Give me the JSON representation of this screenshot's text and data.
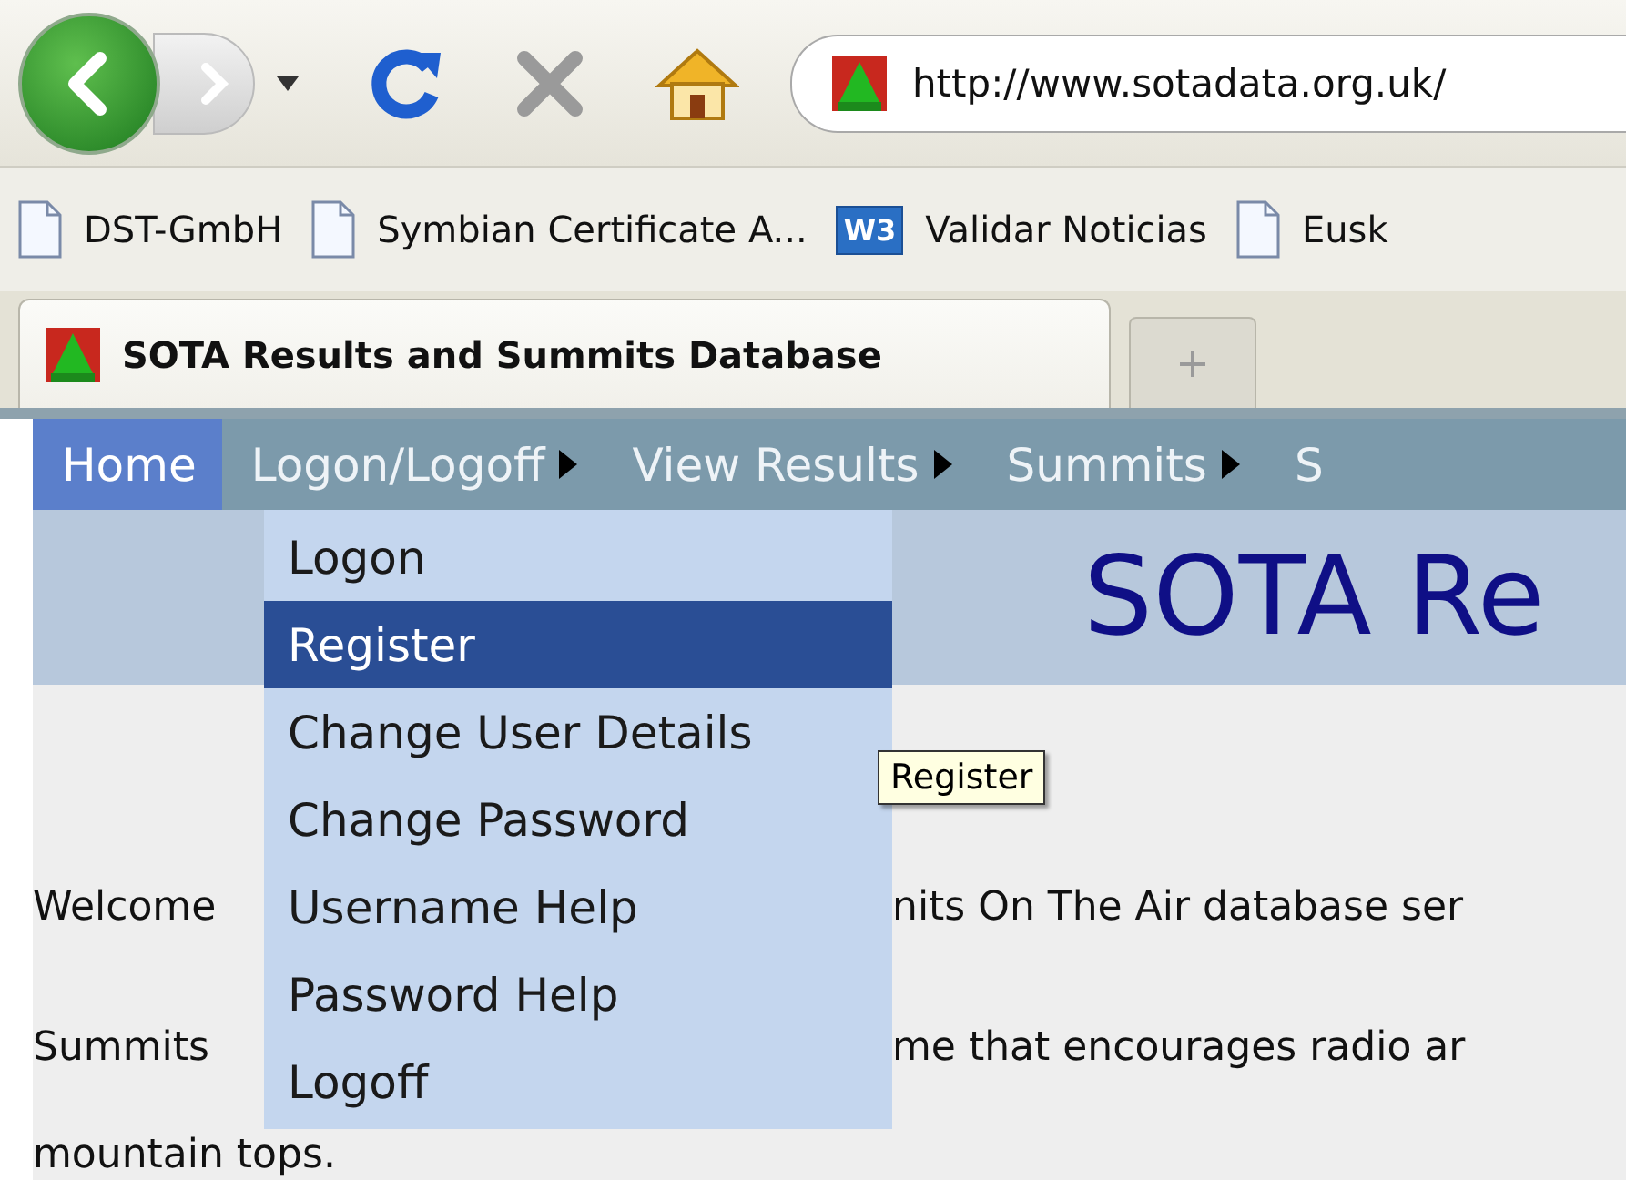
{
  "toolbar": {
    "url": "http://www.sotadata.org.uk/"
  },
  "bookmarks": [
    {
      "label": "DST-GmbH",
      "kind": "page"
    },
    {
      "label": "Symbian Certificate A...",
      "kind": "page"
    },
    {
      "label": "Validar Noticias",
      "kind": "w3",
      "badge": "W3"
    },
    {
      "label": "Eusk",
      "kind": "page"
    }
  ],
  "tabs": [
    {
      "label": "SOTA Results and Summits Database",
      "selected": true
    }
  ],
  "nav": [
    {
      "label": "Home",
      "selected": true,
      "submenu": false
    },
    {
      "label": "Logon/Logoff",
      "selected": false,
      "submenu": true
    },
    {
      "label": "View Results",
      "selected": false,
      "submenu": true
    },
    {
      "label": "Summits",
      "selected": false,
      "submenu": true
    },
    {
      "label": "S",
      "selected": false,
      "submenu": false
    }
  ],
  "header": {
    "title": "SOTA Re"
  },
  "menu": [
    {
      "label": "Logon",
      "selected": false
    },
    {
      "label": "Register",
      "selected": true
    },
    {
      "label": "Change User Details",
      "selected": false
    },
    {
      "label": "Change Password",
      "selected": false
    },
    {
      "label": "Username Help",
      "selected": false
    },
    {
      "label": "Password Help",
      "selected": false
    },
    {
      "label": "Logoff",
      "selected": false
    }
  ],
  "tooltip": "Register",
  "paragraphs": [
    {
      "lines": [
        {
          "left": "Welcome",
          "right": "nits On The Air database ser"
        }
      ]
    },
    {
      "lines": [
        {
          "left": "Summits",
          "right": "me that encourages radio ar"
        },
        {
          "left": "mountain tops."
        }
      ]
    }
  ]
}
